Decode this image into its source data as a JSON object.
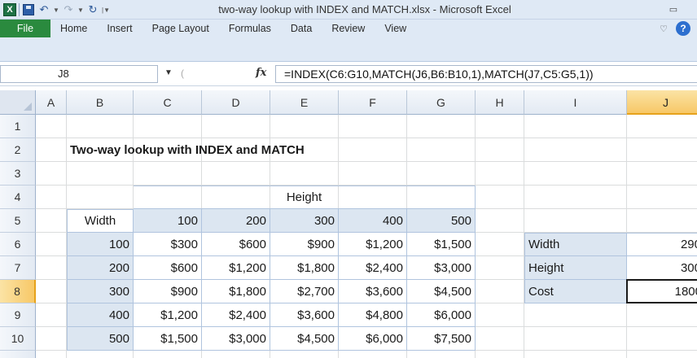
{
  "window": {
    "title": "two-way lookup with INDEX and MATCH.xlsx  -  Microsoft Excel",
    "app_logo": "X"
  },
  "ribbon": {
    "tabs": [
      "File",
      "Home",
      "Insert",
      "Page Layout",
      "Formulas",
      "Data",
      "Review",
      "View"
    ],
    "file_color": "#2a8a3e"
  },
  "formula_bar": {
    "name_box": "J8",
    "fx": "fx",
    "formula": "=INDEX(C6:G10,MATCH(J6,B6:B10,1),MATCH(J7,C5:G5,1))"
  },
  "columns": [
    "A",
    "B",
    "C",
    "D",
    "E",
    "F",
    "G",
    "H",
    "I",
    "J"
  ],
  "rows": [
    "1",
    "2",
    "3",
    "4",
    "5",
    "6",
    "7",
    "8",
    "9",
    "10"
  ],
  "active_cell": {
    "column": "J",
    "row": "8"
  },
  "sheet": {
    "title": "Two-way lookup with INDEX and MATCH",
    "height_header": "Height",
    "width_header": "Width",
    "heights": [
      "100",
      "200",
      "300",
      "400",
      "500"
    ],
    "widths": [
      "100",
      "200",
      "300",
      "400",
      "500"
    ],
    "table": [
      [
        "$300",
        "$600",
        "$900",
        "$1,200",
        "$1,500"
      ],
      [
        "$600",
        "$1,200",
        "$1,800",
        "$2,400",
        "$3,000"
      ],
      [
        "$900",
        "$1,800",
        "$2,700",
        "$3,600",
        "$4,500"
      ],
      [
        "$1,200",
        "$2,400",
        "$3,600",
        "$4,800",
        "$6,000"
      ],
      [
        "$1,500",
        "$3,000",
        "$4,500",
        "$6,000",
        "$7,500"
      ]
    ],
    "lookup": [
      {
        "label": "Width",
        "value": "290"
      },
      {
        "label": "Height",
        "value": "300"
      },
      {
        "label": "Cost",
        "value": "1800"
      }
    ]
  }
}
